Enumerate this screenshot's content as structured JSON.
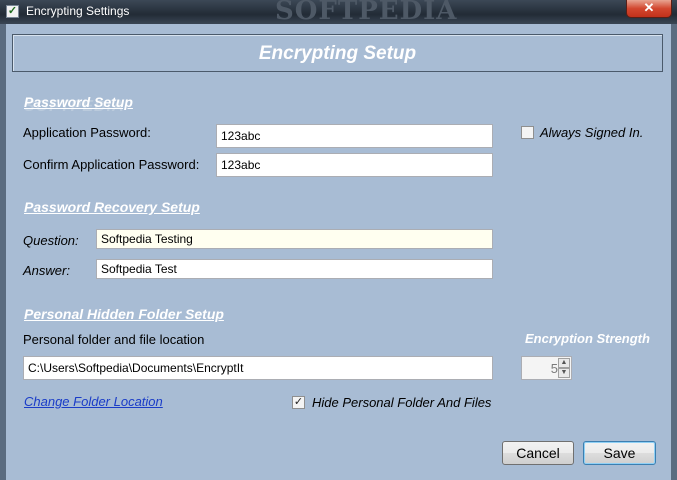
{
  "window": {
    "title": "Encrypting Settings",
    "bg_watermark": "SOFTPEDIA",
    "close_glyph": "✕"
  },
  "header": {
    "title": "Encrypting Setup"
  },
  "watermark": "SOFTPEDIA",
  "password_setup": {
    "section_title": "Password Setup",
    "app_password_label": "Application Password:",
    "app_password_value": "123abc",
    "confirm_password_label": "Confirm Application Password:",
    "confirm_password_value": "123abc",
    "always_signed_in_label": "Always Signed In.",
    "always_signed_in_checked": false
  },
  "recovery_setup": {
    "section_title": "Password Recovery Setup",
    "question_label": "Question:",
    "question_value": "Softpedia Testing",
    "answer_label": "Answer:",
    "answer_value": "Softpedia Test"
  },
  "hidden_folder": {
    "section_title": "Personal Hidden Folder Setup",
    "location_label": "Personal folder and file location",
    "location_value": "C:\\Users\\Softpedia\\Documents\\EncryptIt",
    "change_location_link": "Change Folder Location",
    "hide_label": "Hide Personal Folder And Files",
    "hide_checked": true,
    "check_glyph": "✓"
  },
  "encryption": {
    "strength_label": "Encryption Strength",
    "strength_value": "5",
    "up_glyph": "▲",
    "down_glyph": "▼"
  },
  "buttons": {
    "cancel": "Cancel",
    "save": "Save"
  },
  "colors": {
    "client_bg": "#a8bcd4",
    "section_title": "#ffffff",
    "link": "#1a3cc8",
    "close_button": "#c1311b"
  }
}
